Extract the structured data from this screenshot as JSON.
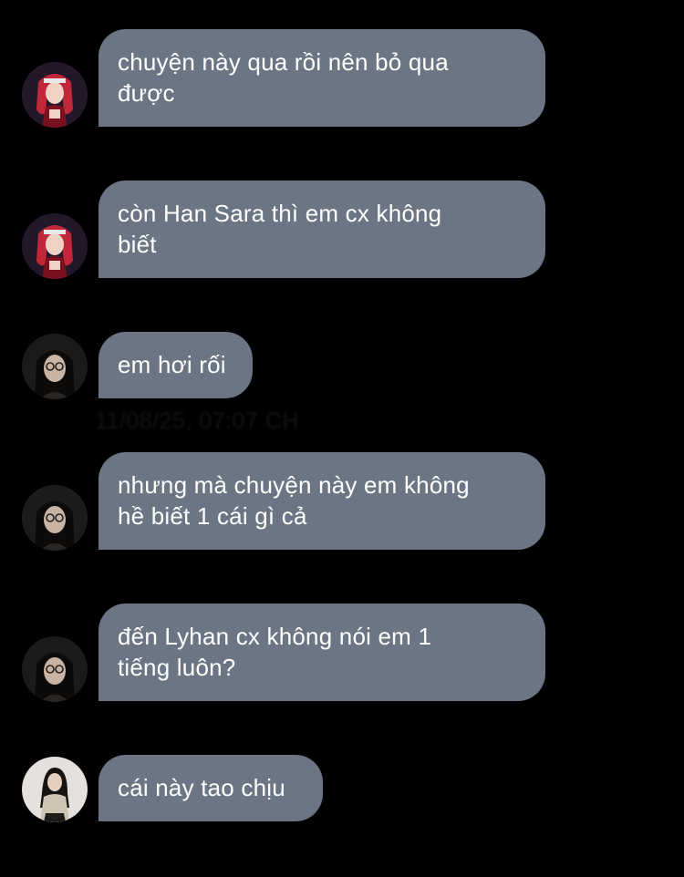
{
  "chat": {
    "messages": [
      {
        "sender": "avatar-red-hair",
        "text": "chuyện này qua rồi nên bỏ qua\nđược"
      },
      {
        "sender": "avatar-red-hair",
        "text": "còn Han Sara thì em cx không\nbiết"
      },
      {
        "sender": "avatar-glasses",
        "text": "em hơi rối"
      },
      {
        "sender": "avatar-glasses",
        "text": "nhưng mà chuyện này em không\nhề biết 1 cái gì cả"
      },
      {
        "sender": "avatar-glasses",
        "text": "đến Lyhan cx không nói em 1\ntiếng luôn?"
      },
      {
        "sender": "avatar-light-top",
        "text": "cái này tao chịu"
      }
    ],
    "timestamps": [
      "11/08/25, 07:07 CH"
    ]
  },
  "colors": {
    "background": "#000000",
    "bubble": "#6b7583",
    "text": "#ffffff",
    "faded_timestamp": "#161616"
  }
}
